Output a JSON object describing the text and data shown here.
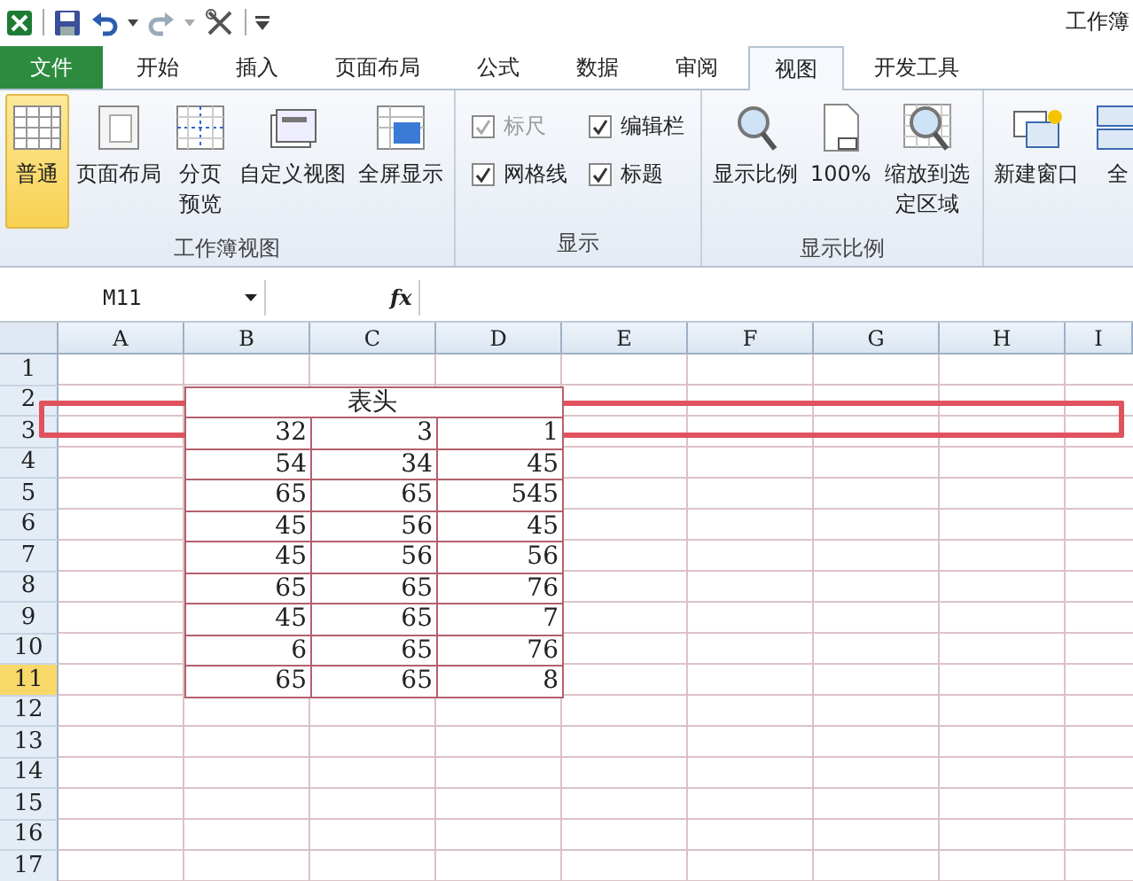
{
  "window": {
    "title": "工作簿"
  },
  "tabs": [
    {
      "label": "文件",
      "kind": "file",
      "selected": false
    },
    {
      "label": "开始",
      "kind": "tab",
      "selected": false
    },
    {
      "label": "插入",
      "kind": "tab",
      "selected": false
    },
    {
      "label": "页面布局",
      "kind": "tab",
      "selected": false
    },
    {
      "label": "公式",
      "kind": "tab",
      "selected": false
    },
    {
      "label": "数据",
      "kind": "tab",
      "selected": false
    },
    {
      "label": "审阅",
      "kind": "tab",
      "selected": false
    },
    {
      "label": "视图",
      "kind": "tab",
      "selected": true
    },
    {
      "label": "开发工具",
      "kind": "tab",
      "selected": false
    }
  ],
  "ribbon": [
    {
      "label": "工作簿视图",
      "items": [
        {
          "kind": "large",
          "label": "普通",
          "selected": true
        },
        {
          "kind": "large",
          "label": "页面布局",
          "selected": false
        },
        {
          "kind": "large",
          "label": "分页预览",
          "selected": false
        },
        {
          "kind": "large",
          "label": "自定义视图",
          "selected": false
        },
        {
          "kind": "large",
          "label": "全屏显示",
          "selected": false
        }
      ]
    },
    {
      "label": "显示",
      "items": [
        {
          "kind": "check",
          "label": "标尺",
          "checked": true,
          "disabled": true
        },
        {
          "kind": "check",
          "label": "编辑栏",
          "checked": true,
          "disabled": false
        },
        {
          "kind": "check",
          "label": "网格线",
          "checked": true,
          "disabled": false
        },
        {
          "kind": "check",
          "label": "标题",
          "checked": true,
          "disabled": false
        }
      ]
    },
    {
      "label": "显示比例",
      "items": [
        {
          "kind": "large",
          "label": "显示比例",
          "selected": false
        },
        {
          "kind": "large",
          "label": "100%",
          "selected": false
        },
        {
          "kind": "large",
          "label": "缩放到选定区域",
          "selected": false
        }
      ]
    },
    {
      "items": [
        {
          "kind": "large",
          "label": "新建窗口",
          "selected": false
        },
        {
          "kind": "large",
          "label": "全",
          "selected": false
        }
      ]
    }
  ],
  "formula_bar": {
    "name_box": "M11",
    "fx": "fx"
  },
  "columns": [
    {
      "label": "A",
      "selected": false
    },
    {
      "label": "B",
      "selected": false
    },
    {
      "label": "C",
      "selected": false
    },
    {
      "label": "D",
      "selected": false
    },
    {
      "label": "E",
      "selected": false
    },
    {
      "label": "F",
      "selected": false
    },
    {
      "label": "G",
      "selected": false
    },
    {
      "label": "H",
      "selected": false
    },
    {
      "label": "I",
      "selected": false
    }
  ],
  "rows": [
    {
      "number": "1",
      "selected": false
    },
    {
      "number": "2",
      "selected": false,
      "merged": "表头"
    },
    {
      "number": "3",
      "selected": false,
      "cells": [
        "32",
        "3",
        "1"
      ]
    },
    {
      "number": "4",
      "selected": false,
      "cells": [
        "54",
        "34",
        "45"
      ]
    },
    {
      "number": "5",
      "selected": false,
      "cells": [
        "65",
        "65",
        "545"
      ]
    },
    {
      "number": "6",
      "selected": false,
      "cells": [
        "45",
        "56",
        "45"
      ]
    },
    {
      "number": "7",
      "selected": false,
      "cells": [
        "45",
        "56",
        "56"
      ]
    },
    {
      "number": "8",
      "selected": false,
      "cells": [
        "65",
        "65",
        "76"
      ]
    },
    {
      "number": "9",
      "selected": false,
      "cells": [
        "45",
        "65",
        "7"
      ]
    },
    {
      "number": "10",
      "selected": false,
      "cells": [
        "6",
        "65",
        "76"
      ]
    },
    {
      "number": "11",
      "selected": true,
      "cells": [
        "65",
        "65",
        "8"
      ]
    },
    {
      "number": "12",
      "selected": false
    },
    {
      "number": "13",
      "selected": false
    },
    {
      "number": "14",
      "selected": false
    },
    {
      "number": "15",
      "selected": false
    },
    {
      "number": "16",
      "selected": false
    },
    {
      "number": "17",
      "selected": false
    }
  ],
  "annotation": {
    "kind": "highlight-frame"
  }
}
